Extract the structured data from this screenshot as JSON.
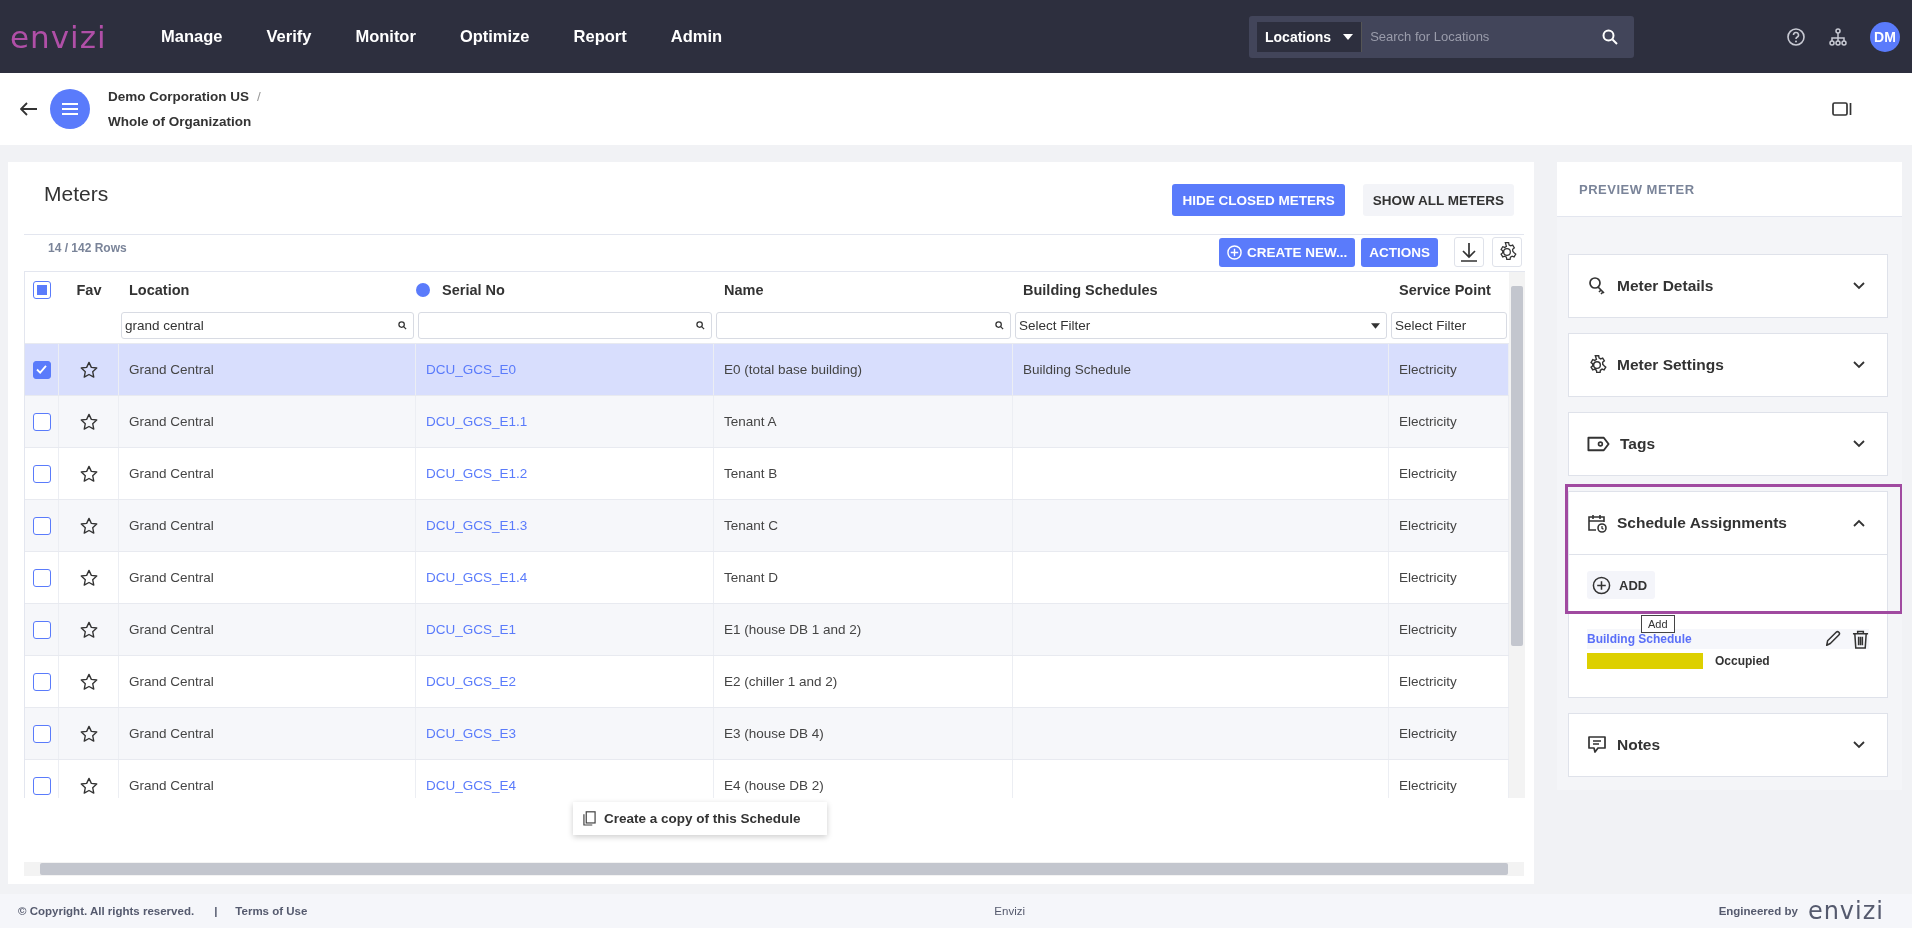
{
  "topbar": {
    "logo": "envizi",
    "nav": [
      "Manage",
      "Verify",
      "Monitor",
      "Optimize",
      "Report",
      "Admin"
    ],
    "search": {
      "scope": "Locations",
      "placeholder": "Search for Locations"
    },
    "avatar": "DM"
  },
  "breadcrumb": {
    "parent": "Demo Corporation US",
    "separator": "/",
    "current": "Whole of Organization"
  },
  "meters": {
    "title": "Meters",
    "hide_closed": "HIDE CLOSED METERS",
    "show_all": "SHOW ALL METERS",
    "row_count": "14 / 142 Rows",
    "create": "CREATE NEW...",
    "actions": "ACTIONS",
    "select_all": {
      "indeterminate": true
    },
    "columns": [
      "Fav",
      "Location",
      "Serial No",
      "Name",
      "Building Schedules",
      "Service Point"
    ],
    "filters": [
      {
        "kind": "text",
        "value": "grand central"
      },
      {
        "kind": "text"
      },
      {
        "kind": "text"
      },
      {
        "kind": "select",
        "placeholder": "Select Filter"
      },
      {
        "kind": "select",
        "placeholder": "Select Filter"
      }
    ],
    "rows": [
      {
        "checked": true,
        "favorite": false,
        "location": "Grand Central",
        "serial": "DCU_GCS_E0",
        "name": "E0 (total base building)",
        "schedule": "Building Schedule",
        "service_point": "Electricity"
      },
      {
        "checked": false,
        "favorite": false,
        "location": "Grand Central",
        "serial": "DCU_GCS_E1.1",
        "name": "Tenant A",
        "service_point": "Electricity"
      },
      {
        "checked": false,
        "favorite": false,
        "location": "Grand Central",
        "serial": "DCU_GCS_E1.2",
        "name": "Tenant B",
        "service_point": "Electricity"
      },
      {
        "checked": false,
        "favorite": false,
        "location": "Grand Central",
        "serial": "DCU_GCS_E1.3",
        "name": "Tenant C",
        "service_point": "Electricity"
      },
      {
        "checked": false,
        "favorite": false,
        "location": "Grand Central",
        "serial": "DCU_GCS_E1.4",
        "name": "Tenant D",
        "service_point": "Electricity"
      },
      {
        "checked": false,
        "favorite": false,
        "location": "Grand Central",
        "serial": "DCU_GCS_E1",
        "name": "E1 (house DB 1 and 2)",
        "service_point": "Electricity"
      },
      {
        "checked": false,
        "favorite": false,
        "location": "Grand Central",
        "serial": "DCU_GCS_E2",
        "name": "E2 (chiller 1 and 2)",
        "service_point": "Electricity"
      },
      {
        "checked": false,
        "favorite": false,
        "location": "Grand Central",
        "serial": "DCU_GCS_E3",
        "name": "E3 (house DB 4)",
        "service_point": "Electricity"
      },
      {
        "checked": false,
        "favorite": false,
        "location": "Grand Central",
        "serial": "DCU_GCS_E4",
        "name": "E4 (house DB 2)",
        "service_point": "Electricity"
      }
    ],
    "context_menu": "Create a copy of this Schedule"
  },
  "preview": {
    "title": "PREVIEW METER",
    "sections": [
      {
        "title": "Meter Details",
        "expanded": false
      },
      {
        "title": "Meter Settings",
        "expanded": false
      },
      {
        "title": "Tags",
        "expanded": false
      },
      {
        "title": "Schedule Assignments",
        "expanded": true,
        "add": "ADD",
        "tooltip": "Add",
        "highlighted": true,
        "assignments": [
          {
            "name": "Building Schedule",
            "color": "#ddd000",
            "label": "Occupied"
          }
        ]
      },
      {
        "title": "Notes",
        "expanded": false
      }
    ]
  },
  "footer": {
    "copyright": "© Copyright. All rights reserved.",
    "separator": "|",
    "terms": "Terms of Use",
    "center": "Envizi",
    "engineered": "Engineered by",
    "logo": "envizi"
  }
}
